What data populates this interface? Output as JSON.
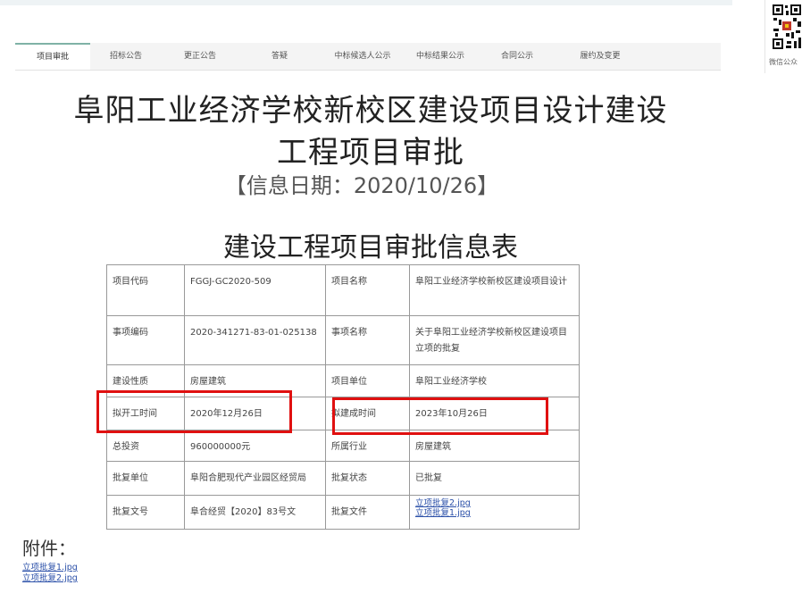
{
  "tabs": [
    {
      "label": "项目审批",
      "active": true
    },
    {
      "label": "招标公告"
    },
    {
      "label": "更正公告"
    },
    {
      "label": "答疑"
    },
    {
      "label": "中标候选人公示"
    },
    {
      "label": "中标结果公示"
    },
    {
      "label": "合同公示"
    },
    {
      "label": "履约及变更"
    }
  ],
  "qr": {
    "caption": "微信公众"
  },
  "header": {
    "title_line1": "阜阳工业经济学校新校区建设项目设计建设",
    "title_line2": "工程项目审批",
    "info_date": "【信息日期：2020/10/26】"
  },
  "table_title": "建设工程项目审批信息表",
  "table": {
    "rows": [
      {
        "k1": "项目代码",
        "v1": "FGGJ-GC2020-509",
        "k2": "项目名称",
        "v2": "阜阳工业经济学校新校区建设项目设计"
      },
      {
        "k1": "事项编码",
        "v1": "2020-341271-83-01-025138",
        "k2": "事项名称",
        "v2": "关于阜阳工业经济学校新校区建设项目立项的批复"
      },
      {
        "k1": "建设性质",
        "v1": "房屋建筑",
        "k2": "项目单位",
        "v2": "阜阳工业经济学校"
      },
      {
        "k1": "拟开工时间",
        "v1": "2020年12月26日",
        "k2": "拟建成时间",
        "v2": "2023年10月26日"
      },
      {
        "k1": "总投资",
        "v1": "960000000元",
        "k2": "所属行业",
        "v2": "房屋建筑"
      },
      {
        "k1": "批复单位",
        "v1": "阜阳合肥现代产业园区经贸局",
        "k2": "批复状态",
        "v2": "已批复"
      },
      {
        "k1": "批复文号",
        "v1": "阜合经贸【2020】83号文",
        "k2": "批复文件",
        "files": [
          "立项批复2.jpg",
          "立项批复1.jpg"
        ]
      }
    ]
  },
  "attachments": {
    "title": "附件：",
    "files": [
      "立项批复1.jpg",
      "立项批复2.jpg"
    ]
  },
  "colors": {
    "highlight": "#e01010",
    "link": "#2a4fa8",
    "tab_accent": "#7fb2a6"
  }
}
